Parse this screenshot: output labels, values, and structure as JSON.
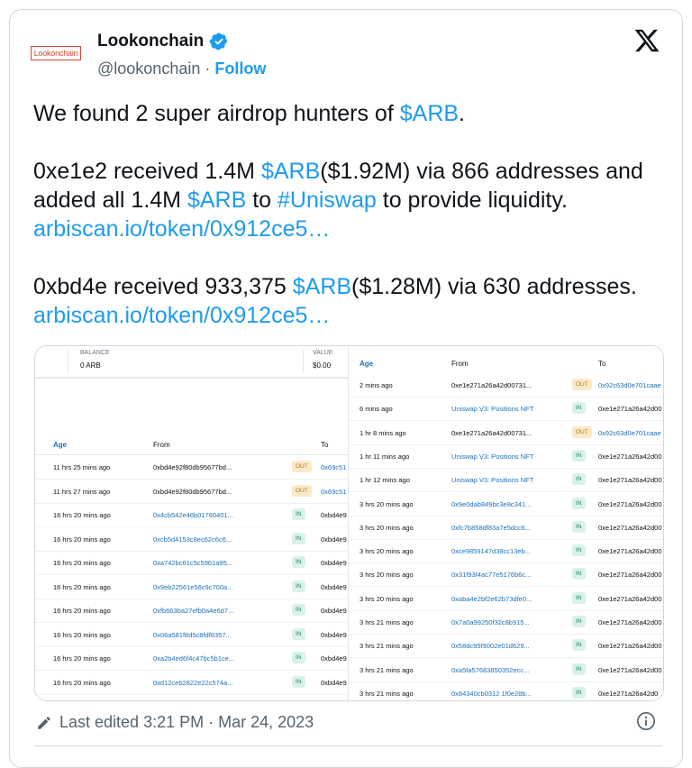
{
  "author": {
    "name": "Lookonchain",
    "avatar_text": "Lookonchain",
    "handle": "@lookonchain",
    "separator": " · ",
    "follow_label": "Follow"
  },
  "tweet": {
    "line1_pre": "We found 2 super airdrop hunters of ",
    "line1_tag": "$ARB",
    "line1_post": ".",
    "p2_a": "0xe1e2 received 1.4M ",
    "p2_tag1": "$ARB",
    "p2_b": "($1.92M) via 866 addresses and added all 1.4M ",
    "p2_tag2": "$ARB",
    "p2_c": " to ",
    "p2_tag3": "#Uniswap",
    "p2_d": " to provide liquidity. ",
    "p2_link": "arbiscan.io/token/0x912ce5…",
    "p3_a": "0xbd4e received 933,375 ",
    "p3_tag": "$ARB",
    "p3_b": "($1.28M) via 630 addresses. ",
    "p3_link": "arbiscan.io/token/0x912ce5…"
  },
  "left_image": {
    "balance_label": "BALANCE",
    "balance_value": "0 ARB",
    "value_label": "VALUE",
    "value_value": "$0.00",
    "headers": {
      "age": "Age",
      "from": "From",
      "to": "To"
    },
    "rows": [
      {
        "age": "11 hrs 25 mins ago",
        "from": "0xbd4e92f80db95677bd...",
        "dir": "OUT",
        "to": "0x69c51"
      },
      {
        "age": "11 hrs 27 mins ago",
        "from": "0xbd4e92f80db95677bd...",
        "dir": "OUT",
        "to": "0x69c51"
      },
      {
        "age": "16 hrs 20 mins ago",
        "from": "0x4cb542e46b01760401...",
        "dir": "IN",
        "to": "0xbd4e9"
      },
      {
        "age": "16 hrs 20 mins ago",
        "from": "0xcb5d4153c8ec62c6c6...",
        "dir": "IN",
        "to": "0xbd4e9"
      },
      {
        "age": "16 hrs 20 mins ago",
        "from": "0xa742bc61c5c5961a95...",
        "dir": "IN",
        "to": "0xbd4e9"
      },
      {
        "age": "16 hrs 20 mins ago",
        "from": "0x9eb22561e56c9c700a...",
        "dir": "IN",
        "to": "0xbd4e9"
      },
      {
        "age": "16 hrs 20 mins ago",
        "from": "0xfb663ba27efb0a4e6d7...",
        "dir": "IN",
        "to": "0xbd4e9"
      },
      {
        "age": "16 hrs 20 mins ago",
        "from": "0x06a581f8d5c8fdf8357...",
        "dir": "IN",
        "to": "0xbd4e9"
      },
      {
        "age": "16 hrs 20 mins ago",
        "from": "0xa2b4ed6f4c47bc5b1ce...",
        "dir": "IN",
        "to": "0xbd4e9"
      },
      {
        "age": "16 hrs 20 mins ago",
        "from": "0xd12ceb2822e22c574a...",
        "dir": "IN",
        "to": "0xbd4e9"
      }
    ]
  },
  "right_image": {
    "headers": {
      "age": "Age",
      "from": "From",
      "to": "To"
    },
    "rows": [
      {
        "age": "2 mins ago",
        "from": "0xe1e271a26a42d00731...",
        "dir": "OUT",
        "to": "0x92c63d0e701caae"
      },
      {
        "age": "6 mins ago",
        "from": "Uniswap V3: Positions NFT",
        "dir": "IN",
        "to": "0xe1e271a26a42d00"
      },
      {
        "age": "1 hr 8 mins ago",
        "from": "0xe1e271a26a42d00731...",
        "dir": "OUT",
        "to": "0x92c63d0e701caae"
      },
      {
        "age": "1 hr 11 mins ago",
        "from": "Uniswap V3: Positions NFT",
        "dir": "IN",
        "to": "0xe1e271a26a42d00"
      },
      {
        "age": "1 hr 12 mins ago",
        "from": "Uniswap V3: Positions NFT",
        "dir": "IN",
        "to": "0xe1e271a26a42d00"
      },
      {
        "age": "3 hrs 20 mins ago",
        "from": "0x9e0dab849bc3e8c341...",
        "dir": "IN",
        "to": "0xe1e271a26a42d00"
      },
      {
        "age": "3 hrs 20 mins ago",
        "from": "0xfc7b858df83a7e5dcc6...",
        "dir": "IN",
        "to": "0xe1e271a26a42d00"
      },
      {
        "age": "3 hrs 20 mins ago",
        "from": "0xce9859147d38cc13eb...",
        "dir": "IN",
        "to": "0xe1e271a26a42d00"
      },
      {
        "age": "3 hrs 20 mins ago",
        "from": "0x31f93f4ac77e5176b6c...",
        "dir": "IN",
        "to": "0xe1e271a26a42d00"
      },
      {
        "age": "3 hrs 20 mins ago",
        "from": "0xaba4e2bf2e62b73dfe0...",
        "dir": "IN",
        "to": "0xe1e271a26a42d00"
      },
      {
        "age": "3 hrs 21 mins ago",
        "from": "0x7a0a99250f32c8b915...",
        "dir": "IN",
        "to": "0xe1e271a26a42d00"
      },
      {
        "age": "3 hrs 21 mins ago",
        "from": "0x58dc95f9002e01d629...",
        "dir": "IN",
        "to": "0xe1e271a26a42d00"
      },
      {
        "age": "3 hrs 21 mins ago",
        "from": "0xa5fa57683850352ecc...",
        "dir": "IN",
        "to": "0xe1e271a26a42d00"
      },
      {
        "age": "3 hrs 21 mins ago",
        "from": "0x84340cb0312 1f0e28b...",
        "dir": "IN",
        "to": "0xe1e271a26a42d0"
      }
    ]
  },
  "footer": {
    "edited": "Last edited 3:21 PM · Mar 24, 2023"
  },
  "colors": {
    "accent": "#1d9bf0",
    "text": "#0f1419",
    "muted": "#536471",
    "border": "#cfd9de"
  },
  "icons": [
    "verified-badge-icon",
    "x-logo-icon",
    "pencil-icon",
    "info-icon"
  ]
}
